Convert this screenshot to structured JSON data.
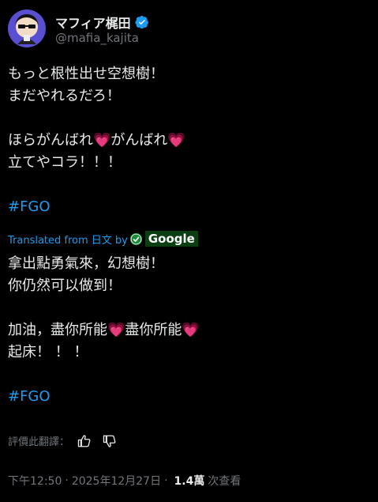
{
  "author": {
    "display_name": "マフィア梶田",
    "handle": "@mafia_kajita",
    "verified": true
  },
  "tweet": {
    "text": "もっと根性出せ空想樹！\nまだやれるだろ！\n\nほらがんばれ💗がんばれ💗\n立てやコラ！！！\n\n",
    "hashtag": "#FGO"
  },
  "translation": {
    "label": "Translated from 日文 by",
    "provider": "Google",
    "text": "拿出點勇氣來，幻想樹！\n你仍然可以做到！\n\n加油，盡你所能💗盡你所能💗\n起床！ ！ ！\n\n",
    "hashtag": "#FGO",
    "rate_label": "評價此翻譯："
  },
  "meta": {
    "time": "下午12:50",
    "date": "2025年12月27日",
    "views_count": "1.4萬",
    "views_label": "次查看"
  },
  "colors": {
    "background": "#000000",
    "text": "#e7e9ea",
    "secondary": "#71767b",
    "link": "#1d9bf0",
    "verified": "#1d9bf0",
    "heart": "#f0a0b0"
  }
}
